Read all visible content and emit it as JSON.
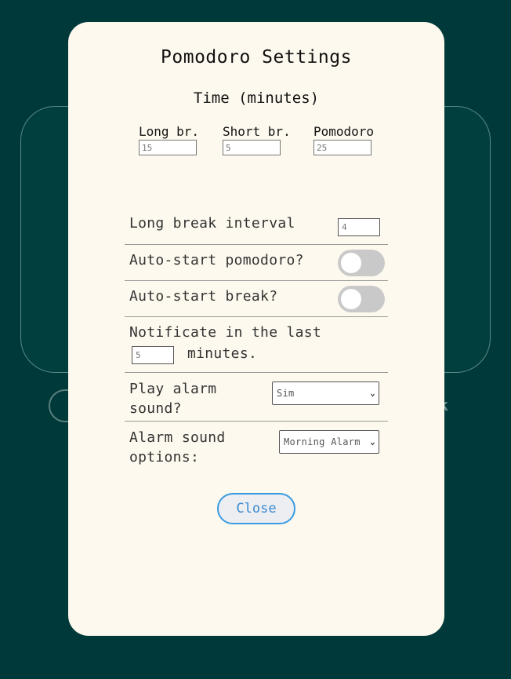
{
  "background": {
    "right_text": "k"
  },
  "modal": {
    "title": "Pomodoro Settings",
    "time_section_title": "Time (minutes)",
    "time_fields": [
      {
        "label": "Long br.",
        "value": "15"
      },
      {
        "label": "Short br.",
        "value": "5"
      },
      {
        "label": "Pomodoro",
        "value": "25"
      }
    ],
    "long_break_interval": {
      "label": "Long break interval",
      "value": "4"
    },
    "auto_start_pomodoro": {
      "label": "Auto-start pomodoro?",
      "enabled": false
    },
    "auto_start_break": {
      "label": "Auto-start break?",
      "enabled": false
    },
    "notification": {
      "label_before": "Notificate in the last",
      "value": "5",
      "label_after": "minutes."
    },
    "play_alarm": {
      "label_line1": "Play alarm",
      "label_line2": "sound?",
      "selected": "Sim"
    },
    "alarm_options": {
      "label_line1": "Alarm sound",
      "label_line2": "options:",
      "selected": "Morning Alarm"
    },
    "close_label": "Close"
  },
  "colors": {
    "background": "#00393a",
    "modal": "#fdf9ee",
    "accent": "#3a9be0",
    "toggle_off": "#c9c9c9"
  }
}
